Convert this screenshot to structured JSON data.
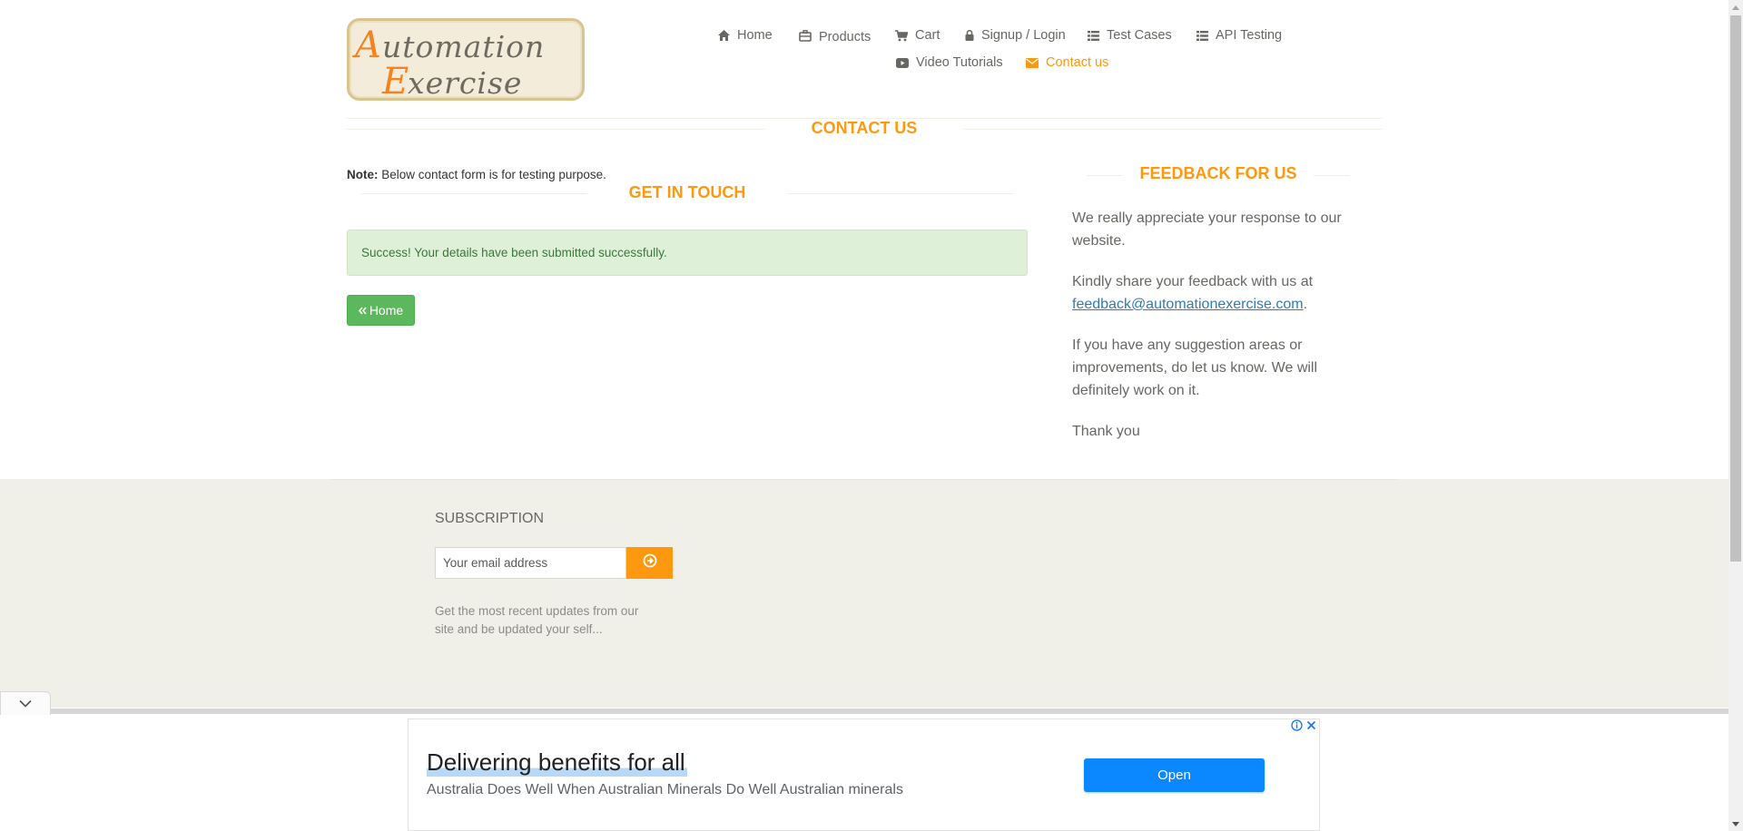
{
  "header": {
    "logo_text_line1": "Automation",
    "logo_text_line2": "Exercise",
    "nav": [
      {
        "label": "Home",
        "icon": "home-icon"
      },
      {
        "label": "Products",
        "icon": "products-icon"
      },
      {
        "label": "Cart",
        "icon": "cart-icon"
      },
      {
        "label": "Signup / Login",
        "icon": "lock-icon"
      },
      {
        "label": "Test Cases",
        "icon": "list-icon"
      },
      {
        "label": "API Testing",
        "icon": "list-icon"
      },
      {
        "label": "Video Tutorials",
        "icon": "youtube-icon"
      },
      {
        "label": "Contact us",
        "icon": "envelope-icon",
        "active": true
      }
    ]
  },
  "contact": {
    "title": "Contact Us",
    "note_label": "Note:",
    "note_text": " Below contact form is for testing purpose.",
    "get_in_touch": "Get In Touch",
    "success_message": "Success! Your details have been submitted successfully.",
    "home_button": "Home"
  },
  "feedback": {
    "title": "Feedback For Us",
    "p1": "We really appreciate your response to our website.",
    "p2_prefix": "Kindly share your feedback with us at ",
    "p2_email": "feedback@automationexercise.com",
    "p2_suffix": ".",
    "p3": "If you have any suggestion areas or improvements, do let us know. We will definitely work on it.",
    "p4": "Thank you"
  },
  "footer": {
    "subscription_title": "Subscription",
    "email_placeholder": "Your email address",
    "subscription_text": "Get the most recent updates from our site and be updated your self..."
  },
  "ad": {
    "headline": "Delivering benefits for all",
    "description": "Australia Does Well When Australian Minerals Do Well Australian minerals",
    "open_button": "Open"
  },
  "colors": {
    "accent": "#FE980F",
    "success_bg": "#dff0d8",
    "success_text": "#3c763d",
    "button_green": "#5cb85c",
    "footer_bg": "#f0f0e9",
    "ad_button": "#0b87ff"
  }
}
